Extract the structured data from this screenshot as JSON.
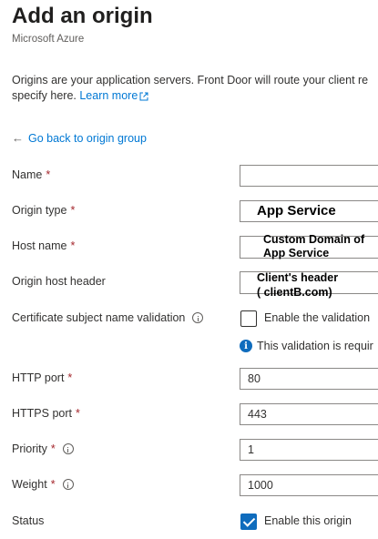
{
  "header": {
    "title": "Add an origin",
    "subtitle": "Microsoft Azure"
  },
  "description": {
    "line1": "Origins are your application servers. Front Door will route your client re",
    "line2": "specify here.",
    "learn_more": "Learn more"
  },
  "back_link": "Go back to origin group",
  "form": {
    "name": {
      "label": "Name",
      "value": ""
    },
    "origin_type": {
      "label": "Origin type",
      "value": "App Service"
    },
    "host_name": {
      "label": "Host name",
      "line1": "Custom Domain of",
      "line2": "App Service"
    },
    "origin_host_header": {
      "label": "Origin host header",
      "line1": "Client's header",
      "line2": "( clientB.com)"
    },
    "cert_validation": {
      "label": "Certificate subject name validation",
      "checkbox_label": "Enable the validation",
      "checked": false
    },
    "validation_note": "This validation is requir",
    "http_port": {
      "label": "HTTP port",
      "value": "80"
    },
    "https_port": {
      "label": "HTTPS port",
      "value": "443"
    },
    "priority": {
      "label": "Priority",
      "value": "1"
    },
    "weight": {
      "label": "Weight",
      "value": "1000"
    },
    "status": {
      "label": "Status",
      "checkbox_label": "Enable this origin",
      "checked": true
    }
  },
  "required_mark": "*",
  "colors": {
    "accent": "#0078d4",
    "checkbox": "#0f6cbd",
    "required": "#a4262c"
  }
}
